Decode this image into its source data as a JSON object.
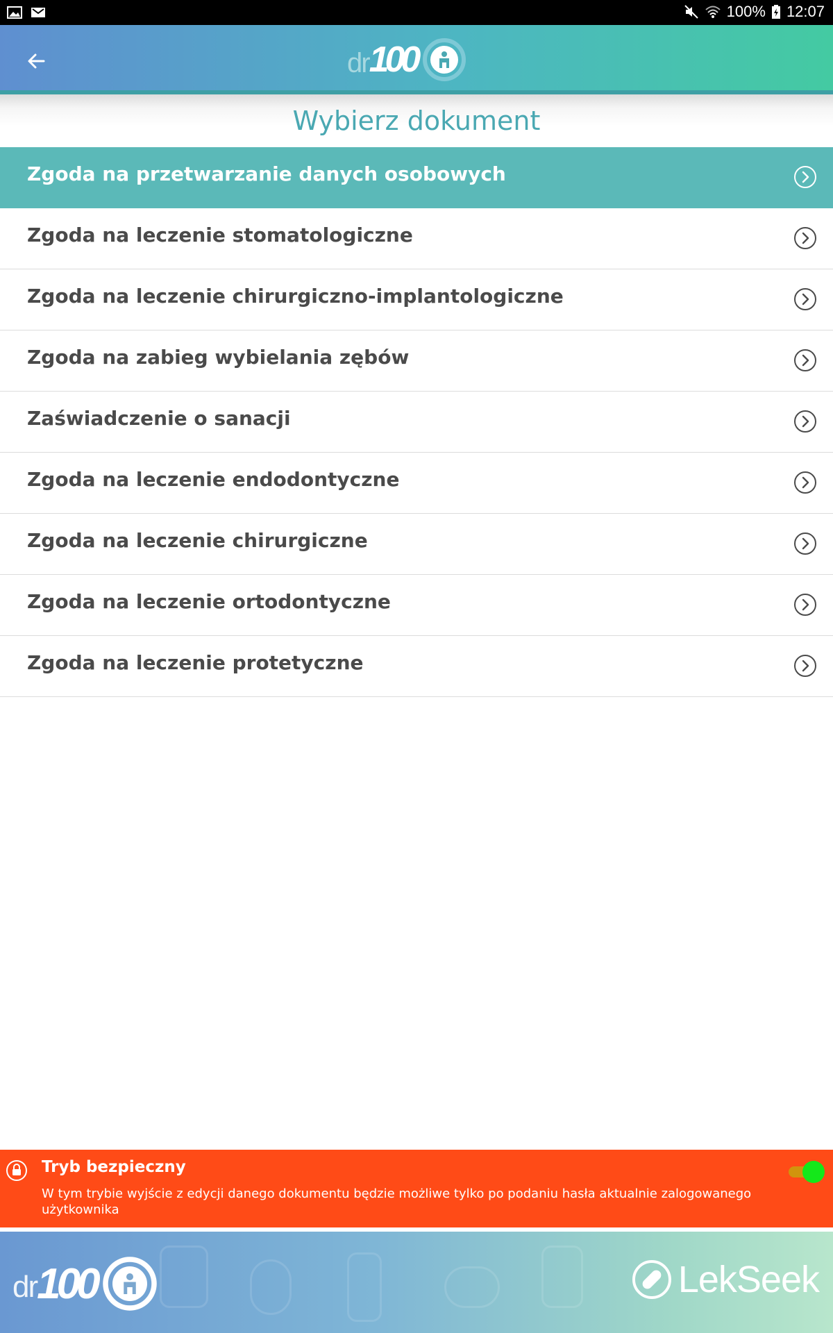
{
  "status_bar": {
    "battery": "100%",
    "time": "12:07"
  },
  "app_bar": {
    "logo_dr": "dr",
    "logo_100": "100"
  },
  "page_title": "Wybierz dokument",
  "documents": [
    {
      "label": "Zgoda na przetwarzanie danych osobowych",
      "selected": true
    },
    {
      "label": "Zgoda na leczenie stomatologiczne",
      "selected": false
    },
    {
      "label": "Zgoda na leczenie chirurgiczno-implantologiczne",
      "selected": false
    },
    {
      "label": "Zgoda na zabieg wybielania zębów",
      "selected": false
    },
    {
      "label": "Zaświadczenie o sanacji",
      "selected": false
    },
    {
      "label": "Zgoda na leczenie endodontyczne",
      "selected": false
    },
    {
      "label": "Zgoda na leczenie chirurgiczne",
      "selected": false
    },
    {
      "label": "Zgoda na leczenie ortodontyczne",
      "selected": false
    },
    {
      "label": "Zgoda na leczenie protetyczne",
      "selected": false
    }
  ],
  "safe_mode": {
    "title": "Tryb bezpieczny",
    "description": "W tym trybie wyjście z edycji danego dokumentu będzie możliwe tylko po podaniu hasła aktualnie zalogowanego użytkownika",
    "enabled": true
  },
  "footer_ad": {
    "logo_dr": "dr",
    "logo_100": "100",
    "partner": "LekSeek"
  },
  "colors": {
    "accent": "#5bb9b8",
    "title": "#4aa8b2",
    "banner": "#ff4b17",
    "toggle_on": "#14e81a"
  }
}
